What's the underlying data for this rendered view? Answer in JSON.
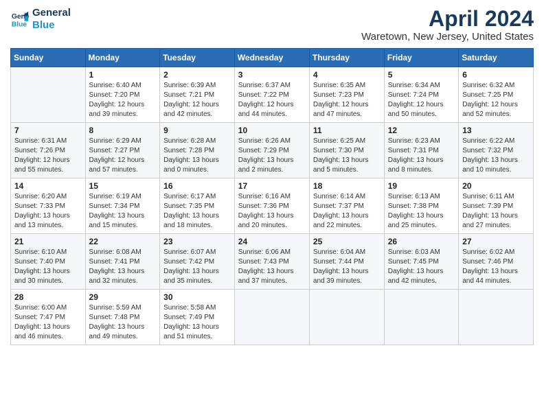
{
  "header": {
    "logo_line1": "General",
    "logo_line2": "Blue",
    "title": "April 2024",
    "subtitle": "Waretown, New Jersey, United States"
  },
  "calendar": {
    "days_of_week": [
      "Sunday",
      "Monday",
      "Tuesday",
      "Wednesday",
      "Thursday",
      "Friday",
      "Saturday"
    ],
    "weeks": [
      [
        {
          "day": "",
          "detail": ""
        },
        {
          "day": "1",
          "detail": "Sunrise: 6:40 AM\nSunset: 7:20 PM\nDaylight: 12 hours\nand 39 minutes."
        },
        {
          "day": "2",
          "detail": "Sunrise: 6:39 AM\nSunset: 7:21 PM\nDaylight: 12 hours\nand 42 minutes."
        },
        {
          "day": "3",
          "detail": "Sunrise: 6:37 AM\nSunset: 7:22 PM\nDaylight: 12 hours\nand 44 minutes."
        },
        {
          "day": "4",
          "detail": "Sunrise: 6:35 AM\nSunset: 7:23 PM\nDaylight: 12 hours\nand 47 minutes."
        },
        {
          "day": "5",
          "detail": "Sunrise: 6:34 AM\nSunset: 7:24 PM\nDaylight: 12 hours\nand 50 minutes."
        },
        {
          "day": "6",
          "detail": "Sunrise: 6:32 AM\nSunset: 7:25 PM\nDaylight: 12 hours\nand 52 minutes."
        }
      ],
      [
        {
          "day": "7",
          "detail": "Sunrise: 6:31 AM\nSunset: 7:26 PM\nDaylight: 12 hours\nand 55 minutes."
        },
        {
          "day": "8",
          "detail": "Sunrise: 6:29 AM\nSunset: 7:27 PM\nDaylight: 12 hours\nand 57 minutes."
        },
        {
          "day": "9",
          "detail": "Sunrise: 6:28 AM\nSunset: 7:28 PM\nDaylight: 13 hours\nand 0 minutes."
        },
        {
          "day": "10",
          "detail": "Sunrise: 6:26 AM\nSunset: 7:29 PM\nDaylight: 13 hours\nand 2 minutes."
        },
        {
          "day": "11",
          "detail": "Sunrise: 6:25 AM\nSunset: 7:30 PM\nDaylight: 13 hours\nand 5 minutes."
        },
        {
          "day": "12",
          "detail": "Sunrise: 6:23 AM\nSunset: 7:31 PM\nDaylight: 13 hours\nand 8 minutes."
        },
        {
          "day": "13",
          "detail": "Sunrise: 6:22 AM\nSunset: 7:32 PM\nDaylight: 13 hours\nand 10 minutes."
        }
      ],
      [
        {
          "day": "14",
          "detail": "Sunrise: 6:20 AM\nSunset: 7:33 PM\nDaylight: 13 hours\nand 13 minutes."
        },
        {
          "day": "15",
          "detail": "Sunrise: 6:19 AM\nSunset: 7:34 PM\nDaylight: 13 hours\nand 15 minutes."
        },
        {
          "day": "16",
          "detail": "Sunrise: 6:17 AM\nSunset: 7:35 PM\nDaylight: 13 hours\nand 18 minutes."
        },
        {
          "day": "17",
          "detail": "Sunrise: 6:16 AM\nSunset: 7:36 PM\nDaylight: 13 hours\nand 20 minutes."
        },
        {
          "day": "18",
          "detail": "Sunrise: 6:14 AM\nSunset: 7:37 PM\nDaylight: 13 hours\nand 22 minutes."
        },
        {
          "day": "19",
          "detail": "Sunrise: 6:13 AM\nSunset: 7:38 PM\nDaylight: 13 hours\nand 25 minutes."
        },
        {
          "day": "20",
          "detail": "Sunrise: 6:11 AM\nSunset: 7:39 PM\nDaylight: 13 hours\nand 27 minutes."
        }
      ],
      [
        {
          "day": "21",
          "detail": "Sunrise: 6:10 AM\nSunset: 7:40 PM\nDaylight: 13 hours\nand 30 minutes."
        },
        {
          "day": "22",
          "detail": "Sunrise: 6:08 AM\nSunset: 7:41 PM\nDaylight: 13 hours\nand 32 minutes."
        },
        {
          "day": "23",
          "detail": "Sunrise: 6:07 AM\nSunset: 7:42 PM\nDaylight: 13 hours\nand 35 minutes."
        },
        {
          "day": "24",
          "detail": "Sunrise: 6:06 AM\nSunset: 7:43 PM\nDaylight: 13 hours\nand 37 minutes."
        },
        {
          "day": "25",
          "detail": "Sunrise: 6:04 AM\nSunset: 7:44 PM\nDaylight: 13 hours\nand 39 minutes."
        },
        {
          "day": "26",
          "detail": "Sunrise: 6:03 AM\nSunset: 7:45 PM\nDaylight: 13 hours\nand 42 minutes."
        },
        {
          "day": "27",
          "detail": "Sunrise: 6:02 AM\nSunset: 7:46 PM\nDaylight: 13 hours\nand 44 minutes."
        }
      ],
      [
        {
          "day": "28",
          "detail": "Sunrise: 6:00 AM\nSunset: 7:47 PM\nDaylight: 13 hours\nand 46 minutes."
        },
        {
          "day": "29",
          "detail": "Sunrise: 5:59 AM\nSunset: 7:48 PM\nDaylight: 13 hours\nand 49 minutes."
        },
        {
          "day": "30",
          "detail": "Sunrise: 5:58 AM\nSunset: 7:49 PM\nDaylight: 13 hours\nand 51 minutes."
        },
        {
          "day": "",
          "detail": ""
        },
        {
          "day": "",
          "detail": ""
        },
        {
          "day": "",
          "detail": ""
        },
        {
          "day": "",
          "detail": ""
        }
      ]
    ]
  }
}
